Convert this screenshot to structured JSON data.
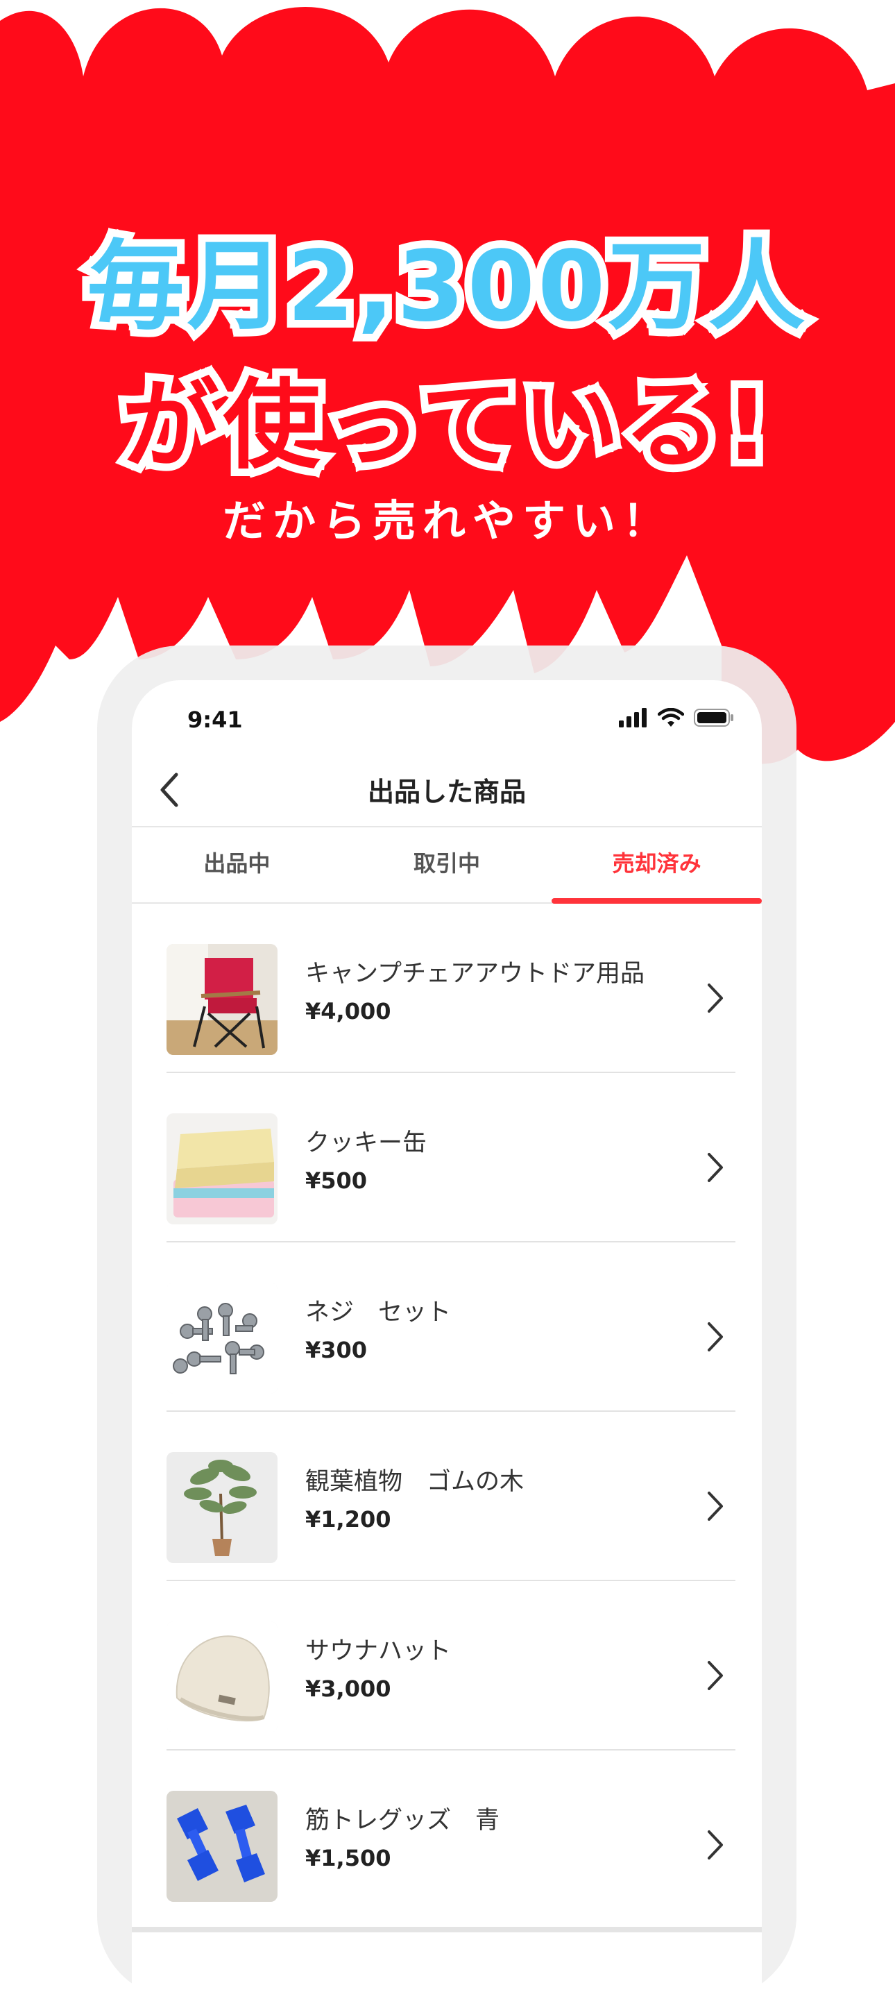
{
  "colors": {
    "brand_red": "#ff0b1a",
    "headline_blue": "#4cc8f7",
    "tab_active": "#ff333a"
  },
  "headline": {
    "line1": "毎月2,300万人",
    "line2": "が使っている!",
    "sub": "だから売れやすい！"
  },
  "status_bar": {
    "time": "9:41",
    "icons": [
      "signal-icon",
      "wifi-icon",
      "battery-icon"
    ]
  },
  "nav": {
    "back_icon": "chevron-left-icon",
    "title": "出品した商品"
  },
  "tabs": [
    {
      "label": "出品中",
      "active": false
    },
    {
      "label": "取引中",
      "active": false
    },
    {
      "label": "売却済み",
      "active": true
    }
  ],
  "items": [
    {
      "title": "キャンプチェアアウトドア用品",
      "price": "¥4,000",
      "image": "camp-chair-photo"
    },
    {
      "title": "クッキー缶",
      "price": "¥500",
      "image": "cookie-tin-photo"
    },
    {
      "title": "ネジ　セット",
      "price": "¥300",
      "image": "screws-photo"
    },
    {
      "title": "観葉植物　ゴムの木",
      "price": "¥1,200",
      "image": "rubber-plant-photo"
    },
    {
      "title": "サウナハット",
      "price": "¥3,000",
      "image": "sauna-hat-photo"
    },
    {
      "title": "筋トレグッズ　青",
      "price": "¥1,500",
      "image": "blue-dumbbells-photo"
    }
  ]
}
